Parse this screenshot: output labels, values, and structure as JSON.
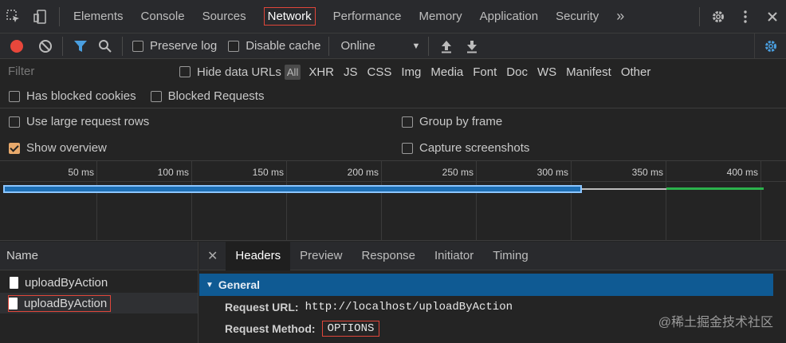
{
  "tabbar": {
    "tabs": [
      "Elements",
      "Console",
      "Sources",
      "Network",
      "Performance",
      "Memory",
      "Application",
      "Security"
    ],
    "active_tab": "Network",
    "more": "»"
  },
  "toolbar": {
    "preserve_log": "Preserve log",
    "disable_cache": "Disable cache",
    "throttle": "Online"
  },
  "filter": {
    "placeholder": "Filter",
    "hide_data_urls": "Hide data URLs",
    "types": [
      "All",
      "XHR",
      "JS",
      "CSS",
      "Img",
      "Media",
      "Font",
      "Doc",
      "WS",
      "Manifest",
      "Other"
    ],
    "has_blocked_cookies": "Has blocked cookies",
    "blocked_requests": "Blocked Requests"
  },
  "settings": {
    "large_rows": "Use large request rows",
    "group_by_frame": "Group by frame",
    "show_overview": "Show overview",
    "capture_screenshots": "Capture screenshots"
  },
  "timeline": {
    "ticks": [
      "50 ms",
      "100 ms",
      "150 ms",
      "200 ms",
      "250 ms",
      "300 ms",
      "350 ms",
      "400 ms"
    ]
  },
  "requests": {
    "header": "Name",
    "rows": [
      "uploadByAction",
      "uploadByAction"
    ]
  },
  "details": {
    "tabs": [
      "Headers",
      "Preview",
      "Response",
      "Initiator",
      "Timing"
    ],
    "active_tab": "Headers",
    "general": "General",
    "request_url_label": "Request URL:",
    "request_url": "http://localhost/uploadByAction",
    "request_method_label": "Request Method:",
    "request_method": "OPTIONS"
  },
  "watermark": "@稀土掘金技术社区"
}
